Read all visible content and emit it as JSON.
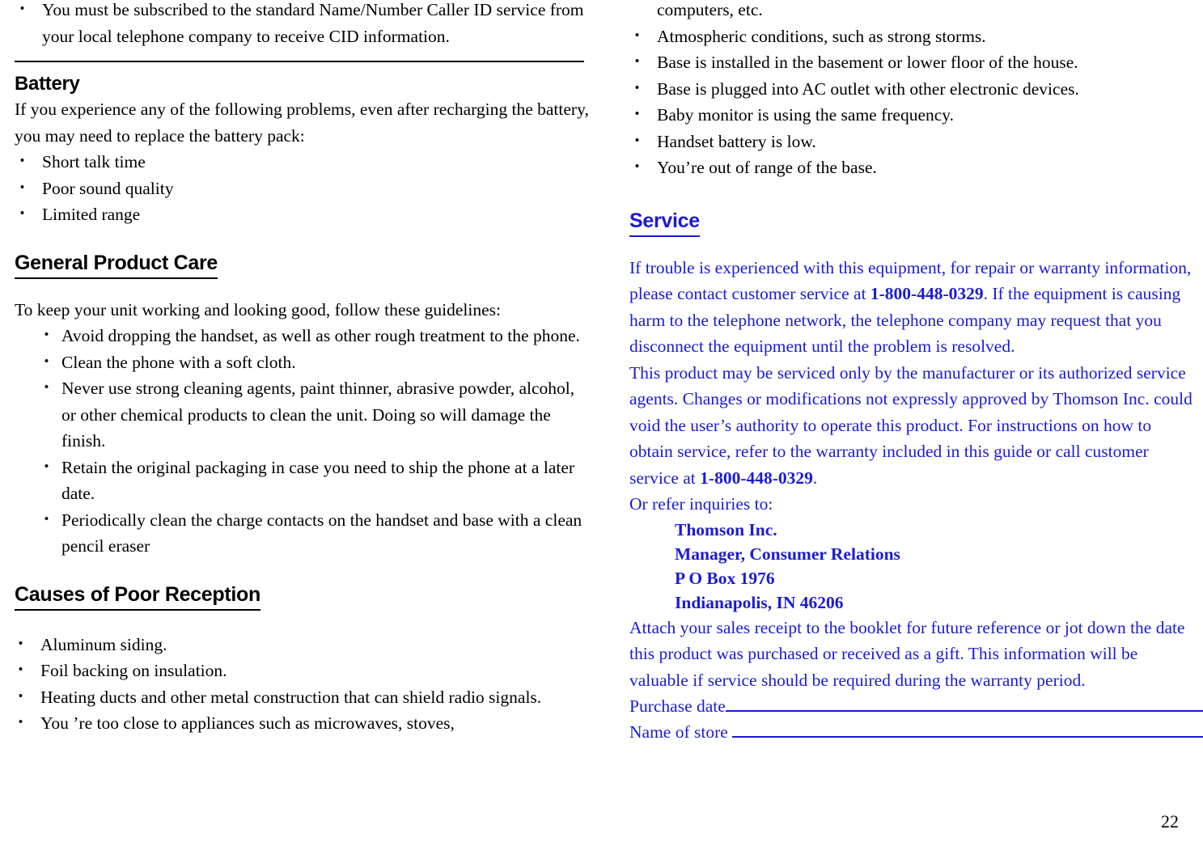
{
  "page": {
    "number": "22",
    "accent_blue": "#1a1ad6",
    "text_black": "#000000"
  },
  "left_column": {
    "cid_bullet": "You must be subscribed to the standard Name/Number Caller ID service from your local telephone company to receive CID information.",
    "battery": {
      "heading": "Battery",
      "intro": "If you experience any of the following problems, even after recharging the battery, you may need to replace the battery pack:",
      "items": [
        "Short talk time",
        "Poor sound quality",
        "Limited range"
      ]
    },
    "general_product_care": {
      "heading": "General Product Care",
      "intro": "To keep your unit working and looking good, follow these guidelines:",
      "items": [
        "Avoid dropping the handset, as well as other rough treatment to the phone.",
        "Clean the phone with a soft cloth.",
        "Never use strong cleaning agents, paint thinner, abrasive powder, alcohol, or other chemical products to clean the unit. Doing so will damage the finish.",
        "Retain the original packaging in case you need to ship the phone at a later date.",
        "Periodically clean the charge contacts on the handset and base with a clean pencil eraser"
      ]
    },
    "causes_of_poor_reception": {
      "heading": "Causes of Poor Reception",
      "items": [
        "Aluminum siding.",
        "Foil backing on insulation.",
        "Heating ducts and other metal construction that can shield radio signals.",
        "You ’re too close to appliances such as microwaves, stoves,"
      ]
    }
  },
  "right_column": {
    "continuation_line": "computers, etc.",
    "reception_items": [
      "Atmospheric conditions, such as strong storms.",
      "Base is installed in the basement or lower floor of the house.",
      "Base is plugged into AC outlet with other electronic devices.",
      "Baby monitor is using the same frequency.",
      "Handset battery is low.",
      "You’re out of range of the base."
    ],
    "service": {
      "heading": "Service",
      "para1_a": "If trouble is experienced with this equipment, for repair or warranty information, please contact customer service at ",
      "para1_phone": "1-800-448-0329",
      "para1_b": ". If the equipment is causing harm to the telephone network, the telephone company may request that you disconnect the equipment until the problem is resolved.",
      "para2_a": "This product may be serviced only by the manufacturer or its authorized service agents. Changes or modifications not expressly approved by Thomson Inc. could void the user’s authority to operate this product. For instructions on how to obtain service, refer to the warranty included in this guide or call customer service at ",
      "para2_phone": "1-800-448-0329",
      "para2_b": ".",
      "refer_line": "Or refer inquiries to:",
      "address": [
        "Thomson Inc.",
        "Manager, Consumer Relations",
        "P O Box 1976",
        "Indianapolis, IN 46206"
      ],
      "para3": "Attach your sales receipt to the booklet for future reference or jot down the date this product was purchased or received as a gift. This information will be valuable if service should be required during the warranty period.",
      "fill_in": {
        "purchase_date_label": "Purchase date",
        "name_of_store_label": "Name of store "
      }
    }
  }
}
